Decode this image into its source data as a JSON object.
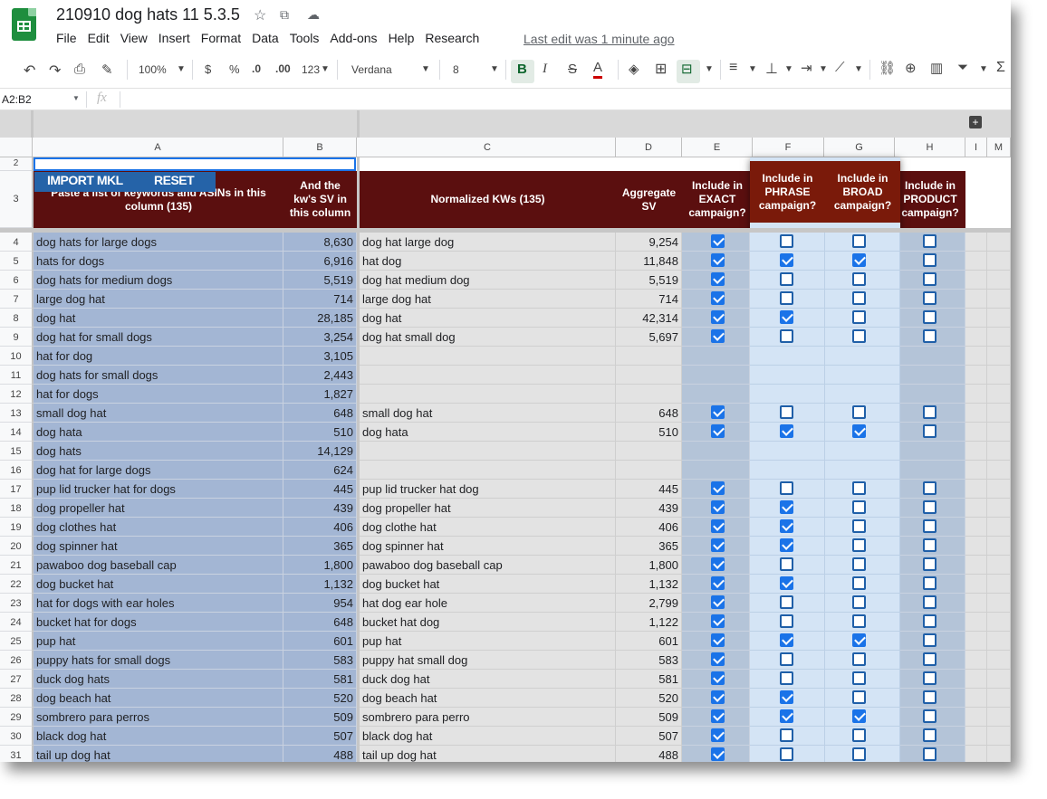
{
  "app": {
    "title": "210910 dog hats 11 5.3.5",
    "menu": [
      "File",
      "Edit",
      "View",
      "Insert",
      "Format",
      "Data",
      "Tools",
      "Add-ons",
      "Help",
      "Research"
    ],
    "last_edit": "Last edit was 1 minute ago"
  },
  "toolbar": {
    "zoom": "100%",
    "currency": "$",
    "percent": "%",
    "dec_less": ".0",
    "dec_more": ".00",
    "more_formats": "123",
    "font": "Verdana",
    "font_size": "8",
    "bold": "B",
    "italic": "I",
    "strike": "S",
    "text_color": "A"
  },
  "formula_bar": {
    "range": "A2:B2",
    "fx": "fx",
    "value": ""
  },
  "columns": [
    "A",
    "B",
    "C",
    "D",
    "E",
    "F",
    "G",
    "H",
    "I",
    "M"
  ],
  "buttons": {
    "import": "IMPORT MKL",
    "reset": "RESET"
  },
  "headers": {
    "a": "Paste a list of keywords and ASINs in this column (135)",
    "b": "And the kw's SV in this column",
    "c": "Normalized KWs (135)",
    "d": "Aggregate SV",
    "e": "Include in EXACT campaign?",
    "f": "Include in PHRASE campaign?",
    "g": "Include in BROAD campaign?",
    "h": "Include in PRODUCT campaign?"
  },
  "row_numbers": {
    "r2": "2",
    "r3": "3"
  },
  "colors": {
    "header_bg": "#5b0f0f",
    "checkbox_blue": "#1a73e8",
    "col_a_bg": "#a3b6d4",
    "col_e_bg": "#b4c4d8"
  },
  "rows": [
    {
      "n": "4",
      "a": "dog hats for large dogs",
      "b": "8,630",
      "c": "dog hat large dog",
      "d": "9,254",
      "e": true,
      "f": false,
      "g": false,
      "h": false
    },
    {
      "n": "5",
      "a": "hats for dogs",
      "b": "6,916",
      "c": "hat dog",
      "d": "11,848",
      "e": true,
      "f": true,
      "g": true,
      "h": false
    },
    {
      "n": "6",
      "a": "dog hats for medium dogs",
      "b": "5,519",
      "c": "dog hat medium dog",
      "d": "5,519",
      "e": true,
      "f": false,
      "g": false,
      "h": false
    },
    {
      "n": "7",
      "a": "large dog hat",
      "b": "714",
      "c": "large dog hat",
      "d": "714",
      "e": true,
      "f": false,
      "g": false,
      "h": false
    },
    {
      "n": "8",
      "a": "dog hat",
      "b": "28,185",
      "c": "dog hat",
      "d": "42,314",
      "e": true,
      "f": true,
      "g": false,
      "h": false
    },
    {
      "n": "9",
      "a": "dog hat for small dogs",
      "b": "3,254",
      "c": "dog hat small dog",
      "d": "5,697",
      "e": true,
      "f": false,
      "g": false,
      "h": false
    },
    {
      "n": "10",
      "a": "hat for dog",
      "b": "3,105",
      "c": "",
      "d": "",
      "e": null,
      "f": null,
      "g": null,
      "h": null
    },
    {
      "n": "11",
      "a": "dog hats for small dogs",
      "b": "2,443",
      "c": "",
      "d": "",
      "e": null,
      "f": null,
      "g": null,
      "h": null
    },
    {
      "n": "12",
      "a": "hat for dogs",
      "b": "1,827",
      "c": "",
      "d": "",
      "e": null,
      "f": null,
      "g": null,
      "h": null
    },
    {
      "n": "13",
      "a": "small dog hat",
      "b": "648",
      "c": "small dog hat",
      "d": "648",
      "e": true,
      "f": false,
      "g": false,
      "h": false
    },
    {
      "n": "14",
      "a": "dog hata",
      "b": "510",
      "c": "dog hata",
      "d": "510",
      "e": true,
      "f": true,
      "g": true,
      "h": false
    },
    {
      "n": "15",
      "a": "dog hats",
      "b": "14,129",
      "c": "",
      "d": "",
      "e": null,
      "f": null,
      "g": null,
      "h": null
    },
    {
      "n": "16",
      "a": "dog hat for large dogs",
      "b": "624",
      "c": "",
      "d": "",
      "e": null,
      "f": null,
      "g": null,
      "h": null
    },
    {
      "n": "17",
      "a": "pup lid trucker hat for dogs",
      "b": "445",
      "c": "pup lid trucker hat dog",
      "d": "445",
      "e": true,
      "f": false,
      "g": false,
      "h": false
    },
    {
      "n": "18",
      "a": "dog propeller hat",
      "b": "439",
      "c": "dog propeller hat",
      "d": "439",
      "e": true,
      "f": true,
      "g": false,
      "h": false
    },
    {
      "n": "19",
      "a": "dog clothes hat",
      "b": "406",
      "c": "dog clothe hat",
      "d": "406",
      "e": true,
      "f": true,
      "g": false,
      "h": false
    },
    {
      "n": "20",
      "a": "dog spinner hat",
      "b": "365",
      "c": "dog spinner hat",
      "d": "365",
      "e": true,
      "f": true,
      "g": false,
      "h": false
    },
    {
      "n": "21",
      "a": "pawaboo dog baseball cap",
      "b": "1,800",
      "c": "pawaboo dog baseball cap",
      "d": "1,800",
      "e": true,
      "f": false,
      "g": false,
      "h": false
    },
    {
      "n": "22",
      "a": "dog bucket hat",
      "b": "1,132",
      "c": "dog bucket hat",
      "d": "1,132",
      "e": true,
      "f": true,
      "g": false,
      "h": false
    },
    {
      "n": "23",
      "a": "hat for dogs with ear holes",
      "b": "954",
      "c": "hat dog ear hole",
      "d": "2,799",
      "e": true,
      "f": false,
      "g": false,
      "h": false
    },
    {
      "n": "24",
      "a": "bucket hat for dogs",
      "b": "648",
      "c": "bucket hat dog",
      "d": "1,122",
      "e": true,
      "f": false,
      "g": false,
      "h": false
    },
    {
      "n": "25",
      "a": "pup hat",
      "b": "601",
      "c": "pup hat",
      "d": "601",
      "e": true,
      "f": true,
      "g": true,
      "h": false
    },
    {
      "n": "26",
      "a": "puppy hats for small dogs",
      "b": "583",
      "c": "puppy hat small dog",
      "d": "583",
      "e": true,
      "f": false,
      "g": false,
      "h": false
    },
    {
      "n": "27",
      "a": "duck dog hats",
      "b": "581",
      "c": "duck dog hat",
      "d": "581",
      "e": true,
      "f": false,
      "g": false,
      "h": false
    },
    {
      "n": "28",
      "a": "dog beach hat",
      "b": "520",
      "c": "dog beach hat",
      "d": "520",
      "e": true,
      "f": true,
      "g": false,
      "h": false
    },
    {
      "n": "29",
      "a": "sombrero para perros",
      "b": "509",
      "c": "sombrero para perro",
      "d": "509",
      "e": true,
      "f": true,
      "g": true,
      "h": false
    },
    {
      "n": "30",
      "a": "black dog hat",
      "b": "507",
      "c": "black dog hat",
      "d": "507",
      "e": true,
      "f": false,
      "g": false,
      "h": false
    },
    {
      "n": "31",
      "a": "tail up dog hat",
      "b": "488",
      "c": "tail up dog hat",
      "d": "488",
      "e": true,
      "f": false,
      "g": false,
      "h": false
    }
  ]
}
